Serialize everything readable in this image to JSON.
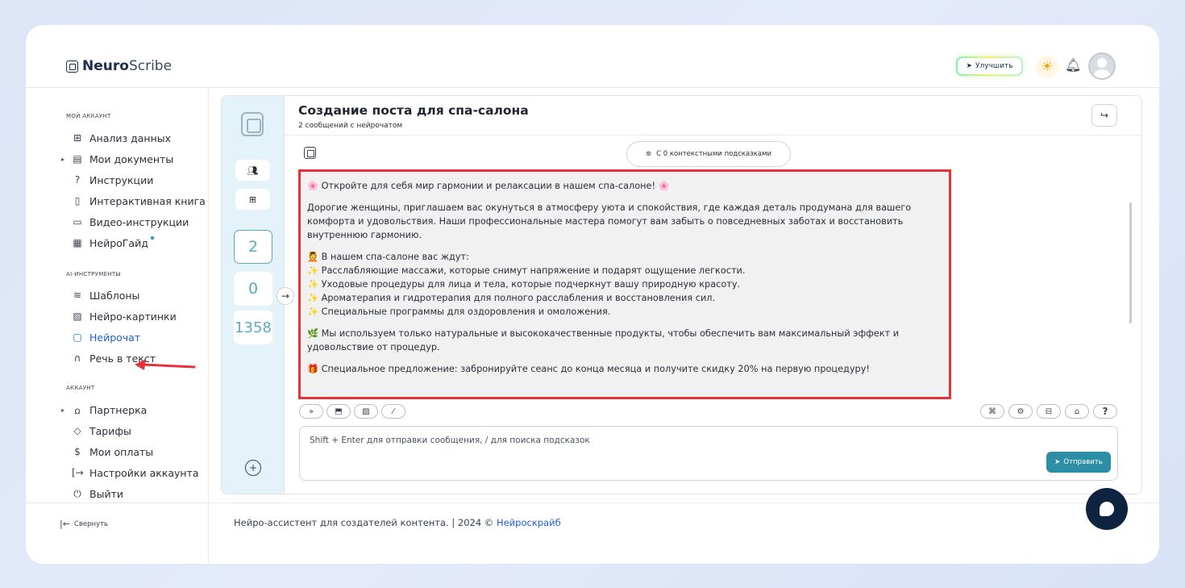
{
  "header": {
    "logo_bold": "Neuro",
    "logo_rest": "Scribe",
    "upgrade_label": "Улучшить"
  },
  "sidebar": {
    "section_account": "МОЙ АККАУНТ",
    "items_account": [
      {
        "label": "Анализ данных",
        "icon": "grid-icon"
      },
      {
        "label": "Мои документы",
        "icon": "document-icon"
      },
      {
        "label": "Инструкции",
        "icon": "help-circle-icon"
      },
      {
        "label": "Интерактивная книга",
        "icon": "book-icon"
      },
      {
        "label": "Видео-инструкции",
        "icon": "video-icon"
      },
      {
        "label": "НейроГайд",
        "icon": "guide-icon"
      }
    ],
    "section_ai": "AI-ИНСТРУМЕНТЫ",
    "items_ai": [
      {
        "label": "Шаблоны",
        "icon": "layers-icon"
      },
      {
        "label": "Нейро-картинки",
        "icon": "image-icon"
      },
      {
        "label": "Нейрочат",
        "icon": "chat-icon"
      },
      {
        "label": "Речь в текст",
        "icon": "headphones-icon"
      }
    ],
    "section_acc2": "АККАУНТ",
    "items_acc2": [
      {
        "label": "Партнерка",
        "icon": "users-icon"
      },
      {
        "label": "Тарифы",
        "icon": "tag-icon"
      },
      {
        "label": "Мои оплаты",
        "icon": "dollar-icon"
      },
      {
        "label": "Настройки аккаунта",
        "icon": "login-icon"
      },
      {
        "label": "Выйти",
        "icon": "power-icon"
      }
    ],
    "collapse_label": "Свернуть"
  },
  "rail": {
    "counters": [
      "2",
      "0",
      "1358"
    ]
  },
  "chat": {
    "title": "Создание поста для спа-салона",
    "subtitle": "2 сообщений с нейрочатом",
    "context_label": "С 0 контекстными подсказками",
    "message": {
      "line1": "🌸 Откройте для себя мир гармонии и релаксации в нашем спа-салоне! 🌸",
      "para1": "Дорогие женщины, приглашаем вас окунуться в атмосферу уюта и спокойствия, где каждая деталь продумана для вашего комфорта и удовольствия. Наши профессиональные мастера помогут вам забыть о повседневных заботах и восстановить внутреннюю гармонию.",
      "list_title": "💆 В нашем спа-салоне вас ждут:",
      "list": [
        "✨ Расслабляющие массажи, которые снимут напряжение и подарят ощущение легкости.",
        "✨ Уходовые процедуры для лица и тела, которые подчеркнут вашу природную красоту.",
        "✨ Ароматерапия и гидротерапия для полного расслабления и восстановления сил.",
        "✨ Специальные программы для оздоровления и омоложения."
      ],
      "para2": "🌿 Мы используем только натуральные и высококачественные продукты, чтобы обеспечить вам максимальный эффект и удовольствие от процедур.",
      "para3": "🎁 Специальное предложение: забронируйте сеанс до конца месяца и получите скидку 20% на первую процедуру!"
    },
    "input_placeholder": "Shift + Enter для отправки сообщения, / для поиска подсказок",
    "send_label": "Отправить"
  },
  "footer": {
    "text": "Нейро-ассистент для создателей контента.  | 2024 © ",
    "brand": "Нейроскрайб"
  }
}
